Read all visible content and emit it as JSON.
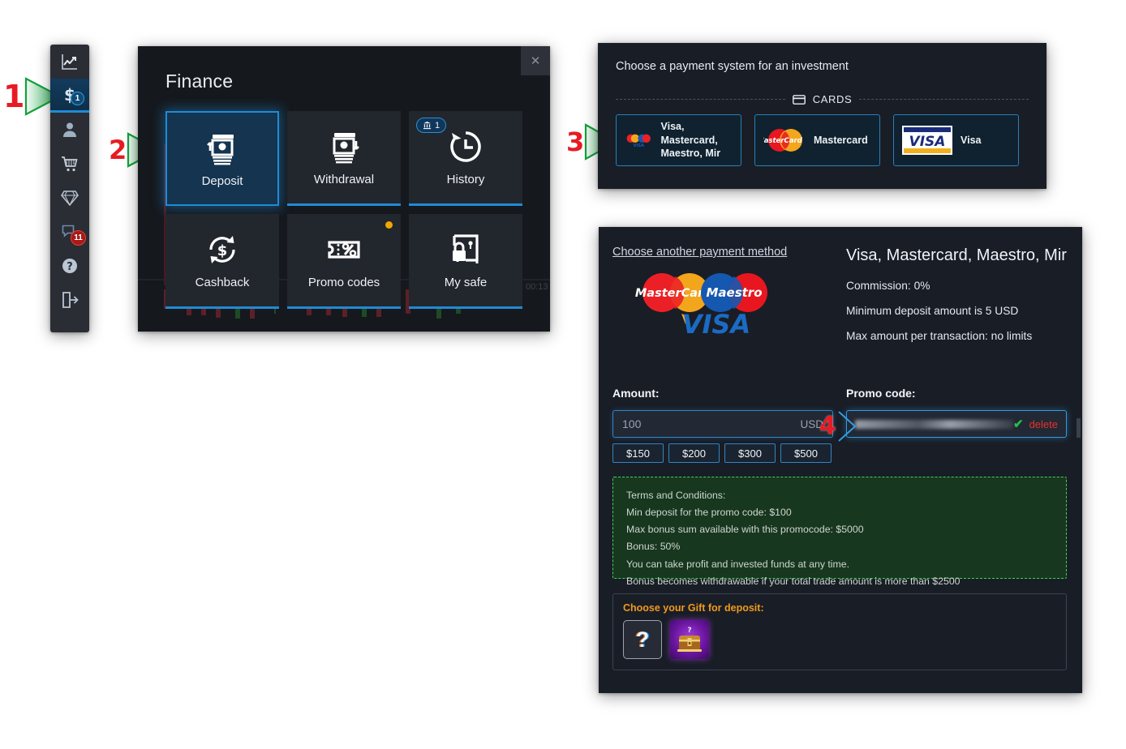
{
  "steps": [
    {
      "num": "1"
    },
    {
      "num": "2"
    },
    {
      "num": "3"
    },
    {
      "num": "4"
    }
  ],
  "sidebar": {
    "items": [
      {
        "name": "chart-icon",
        "label": "Trading",
        "badge": null,
        "badge_type": null,
        "active": false
      },
      {
        "name": "dollar-icon",
        "label": "Finance",
        "badge": "1",
        "badge_type": "blue",
        "active": true
      },
      {
        "name": "user-icon",
        "label": "Profile",
        "badge": null,
        "badge_type": null,
        "active": false
      },
      {
        "name": "cart-icon",
        "label": "Market",
        "badge": null,
        "badge_type": null,
        "active": false
      },
      {
        "name": "diamond-icon",
        "label": "Status",
        "badge": null,
        "badge_type": null,
        "active": false
      },
      {
        "name": "chat-icon",
        "label": "Chat",
        "badge": "11",
        "badge_type": "red",
        "active": false
      },
      {
        "name": "help-icon",
        "label": "Help",
        "badge": null,
        "badge_type": null,
        "active": false
      },
      {
        "name": "logout-icon",
        "label": "Logout",
        "badge": null,
        "badge_type": null,
        "active": false
      }
    ]
  },
  "finance": {
    "title": "Finance",
    "close_label": "✕",
    "tiles": [
      {
        "label": "Deposit",
        "icon": "deposit-icon",
        "selected": true,
        "badge": null,
        "dot": false
      },
      {
        "label": "Withdrawal",
        "icon": "withdrawal-icon",
        "selected": false,
        "badge": null,
        "dot": false
      },
      {
        "label": "History",
        "icon": "history-icon",
        "selected": false,
        "badge": "1",
        "dot": false
      },
      {
        "label": "Cashback",
        "icon": "cashback-icon",
        "selected": false,
        "badge": null,
        "dot": false
      },
      {
        "label": "Promo codes",
        "icon": "promo-icon",
        "selected": false,
        "badge": null,
        "dot": true
      },
      {
        "label": "My safe",
        "icon": "safe-icon",
        "selected": false,
        "badge": null,
        "dot": false
      }
    ]
  },
  "payment_system": {
    "title": "Choose a payment system for an investment",
    "section_label": "CARDS",
    "options": [
      {
        "label": "Visa, Mastercard,\nMaestro,  Mir",
        "logo": "combo-cards-logo"
      },
      {
        "label": "Mastercard",
        "logo": "mastercard-logo"
      },
      {
        "label": "Visa",
        "logo": "visa-logo"
      }
    ]
  },
  "deposit": {
    "change_method_link": "Choose another payment method",
    "method_title": "Visa, Mastercard, Maestro, Mir",
    "info_lines": [
      "Commission: 0%",
      "Minimum deposit amount is 5 USD",
      "Max amount per transaction: no limits"
    ],
    "amount_label": "Amount:",
    "amount_value": "100",
    "amount_currency": "USD",
    "quick_amounts": [
      "$150",
      "$200",
      "$300",
      "$500"
    ],
    "promo_label": "Promo code:",
    "promo_value": "",
    "promo_check_icon": "✔",
    "promo_delete_label": "delete",
    "terms": [
      "Terms and Conditions:",
      "Min deposit for the promo code: $100",
      "Max bonus sum available with this promocode: $5000",
      "Bonus: 50%",
      "You can take profit and invested funds at any time.",
      "Bonus becomes withdrawable if your total trade amount is more than $2500"
    ],
    "gift_title": "Choose your Gift for deposit:",
    "gifts": [
      {
        "name": "gift-unknown",
        "glyph": "?"
      },
      {
        "name": "gift-chest",
        "glyph": ""
      }
    ]
  },
  "colors": {
    "accent_blue": "#1f8bd6",
    "arrow_green": "#12a23c",
    "step_red": "#e81b23",
    "gift_orange": "#f09a1e",
    "terms_green": "#3fd35a",
    "delete_red": "#e8342b",
    "check_green": "#20c24a"
  }
}
